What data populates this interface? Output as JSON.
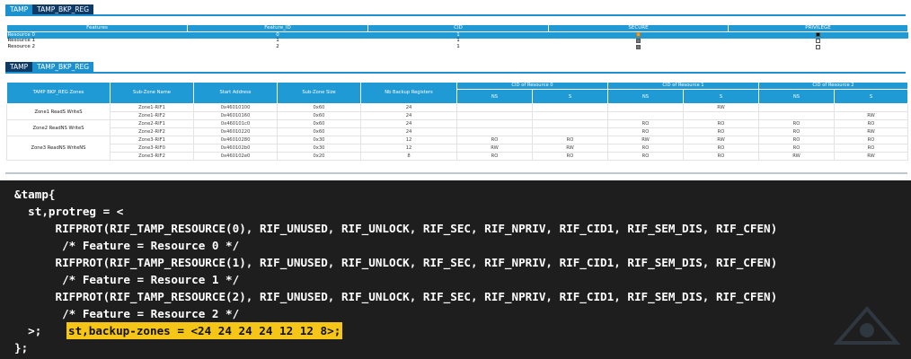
{
  "top_tabs": [
    "TAMP",
    "TAMP_BKP_REG"
  ],
  "resources_table": {
    "headers": [
      "Features",
      "Feature_ID",
      "CID",
      "SECURE",
      "PRIVILEGE"
    ],
    "rows": [
      {
        "feature": "Resource 0",
        "id": "0",
        "cid": "1",
        "secure": "checked-orange",
        "privilege": "checked",
        "selected": true
      },
      {
        "feature": "Resource 1",
        "id": "1",
        "cid": "1",
        "secure": "checked",
        "privilege": "unchecked",
        "selected": false
      },
      {
        "feature": "Resource 2",
        "id": "2",
        "cid": "1",
        "secure": "checked",
        "privilege": "unchecked",
        "selected": false
      }
    ]
  },
  "bkp_tabs": [
    "TAMP",
    "TAMP_BKP_REG"
  ],
  "bkp_table": {
    "headers": [
      "TAMP BKP_REG Zones",
      "Sub-Zone Name",
      "Start Address",
      "Sub-Zone Size",
      "Nb Backup Registers"
    ],
    "cid_groups": [
      "CID of Resource 0",
      "CID of Resource 1",
      "CID of Resource 2"
    ],
    "cid_sub": [
      "NS",
      "S",
      "NS",
      "S",
      "NS",
      "S"
    ],
    "zones": [
      {
        "name": "Zone1 ReadS WriteS",
        "rows": [
          {
            "sub": "Zone1-RIF1",
            "addr": "0x46010100",
            "size": "0x60",
            "nb": "24",
            "c": [
              "",
              "",
              "",
              "RW",
              "",
              ""
            ]
          },
          {
            "sub": "Zone1-RIF2",
            "addr": "0x46010160",
            "size": "0x60",
            "nb": "24",
            "c": [
              "",
              "",
              "",
              "",
              "",
              "RW"
            ]
          }
        ]
      },
      {
        "name": "Zone2 ReadNS WriteS",
        "rows": [
          {
            "sub": "Zone2-RIF1",
            "addr": "0x460101c0",
            "size": "0x60",
            "nb": "24",
            "c": [
              "",
              "",
              "RO",
              "RO",
              "RO",
              "RO"
            ]
          },
          {
            "sub": "Zone2-RIF2",
            "addr": "0x46010220",
            "size": "0x60",
            "nb": "24",
            "c": [
              "",
              "",
              "RO",
              "RO",
              "RO",
              "RW"
            ]
          }
        ]
      },
      {
        "name": "Zone3 ReadNS WriteNS",
        "rows": [
          {
            "sub": "Zone3-RIF1",
            "addr": "0x46010280",
            "size": "0x30",
            "nb": "12",
            "c": [
              "RO",
              "RO",
              "RW",
              "RW",
              "RO",
              "RO"
            ]
          },
          {
            "sub": "Zone3-RIF0",
            "addr": "0x460102b0",
            "size": "0x30",
            "nb": "12",
            "c": [
              "RW",
              "RW",
              "RO",
              "RO",
              "RO",
              "RO"
            ]
          },
          {
            "sub": "Zone3-RIF2",
            "addr": "0x460102e0",
            "size": "0x20",
            "nb": "8",
            "c": [
              "RO",
              "RO",
              "RO",
              "RO",
              "RW",
              "RW"
            ]
          }
        ]
      }
    ]
  },
  "code_lines": [
    "&tamp{",
    "  st,protreg = <",
    "      RIFPROT(RIF_TAMP_RESOURCE(0), RIF_UNUSED, RIF_UNLOCK, RIF_SEC, RIF_NPRIV, RIF_CID1, RIF_SEM_DIS, RIF_CFEN)",
    "       /* Feature = Resource 0 */",
    "      RIFPROT(RIF_TAMP_RESOURCE(1), RIF_UNUSED, RIF_UNLOCK, RIF_SEC, RIF_NPRIV, RIF_CID1, RIF_SEM_DIS, RIF_CFEN)",
    "       /* Feature = Resource 1 */",
    "      RIFPROT(RIF_TAMP_RESOURCE(2), RIF_UNUSED, RIF_UNLOCK, RIF_SEC, RIF_NPRIV, RIF_CID1, RIF_SEM_DIS, RIF_CFEN)",
    "       /* Feature = Resource 2 */",
    "  >;  ",
    "};"
  ],
  "code_highlight": "st,backup-zones = <24 24 24 24 12 12 8>;",
  "colors": {
    "accent": "#1f9ad5",
    "tab_dark": "#0e3a66",
    "highlight": "#f5c518",
    "code_bg": "#1e1e1e"
  }
}
